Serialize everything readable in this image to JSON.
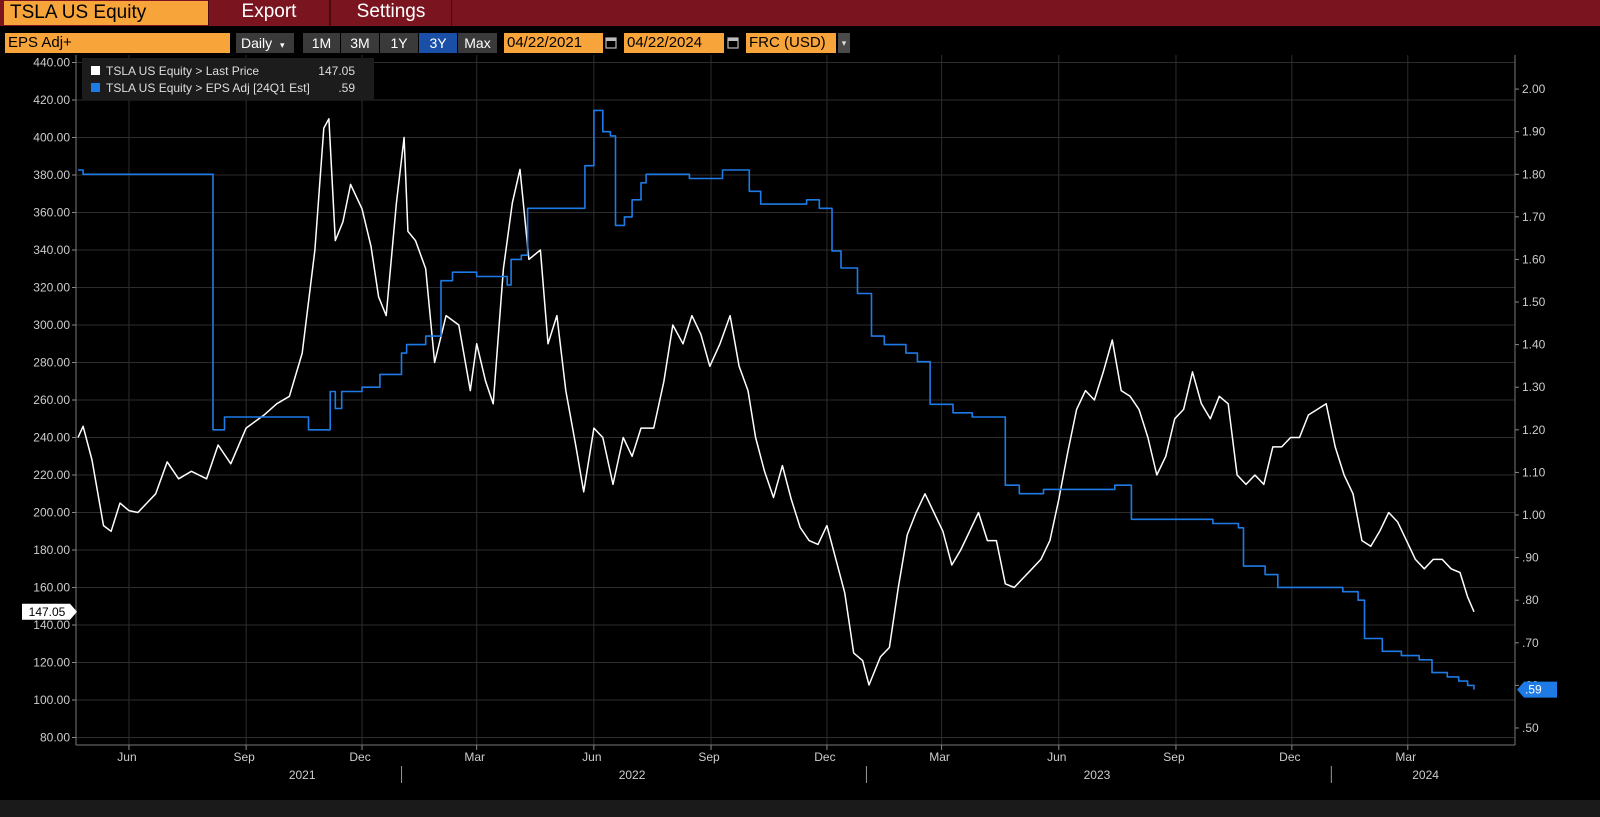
{
  "header": {
    "security": "TSLA US Equity",
    "menu": [
      "Export",
      "Settings"
    ]
  },
  "toolbar": {
    "field": "EPS Adj+",
    "periodicity": "Daily",
    "ranges": [
      "1M",
      "3M",
      "1Y",
      "3Y",
      "Max"
    ],
    "selected_range": "3Y",
    "start_date": "04/22/2021",
    "end_date": "04/22/2024",
    "currency": "FRC (USD)"
  },
  "colors": {
    "brand_bar": "#7a1520",
    "accent_orange": "#f7a43a",
    "price_line": "#ffffff",
    "eps_line": "#1e7be6",
    "grid": "#2c2c2c"
  },
  "chart_data": {
    "type": "line",
    "x_domain": [
      "2021-04-22",
      "2024-04-22"
    ],
    "x_month_ticks": [
      {
        "label": "Jun",
        "date": "2021-06-01"
      },
      {
        "label": "Sep",
        "date": "2021-09-01"
      },
      {
        "label": "Dec",
        "date": "2021-12-01"
      },
      {
        "label": "Mar",
        "date": "2022-03-01"
      },
      {
        "label": "Jun",
        "date": "2022-06-01"
      },
      {
        "label": "Sep",
        "date": "2022-09-01"
      },
      {
        "label": "Dec",
        "date": "2022-12-01"
      },
      {
        "label": "Mar",
        "date": "2023-03-01"
      },
      {
        "label": "Jun",
        "date": "2023-06-01"
      },
      {
        "label": "Sep",
        "date": "2023-09-01"
      },
      {
        "label": "Dec",
        "date": "2023-12-01"
      },
      {
        "label": "Mar",
        "date": "2024-03-01"
      }
    ],
    "x_year_labels": [
      {
        "label": "2021",
        "date": "2021-10-15"
      },
      {
        "label": "2022",
        "date": "2022-07-01"
      },
      {
        "label": "2023",
        "date": "2023-07-01"
      },
      {
        "label": "2024",
        "date": "2024-03-15"
      }
    ],
    "x_year_separators": [
      "2022-01-01",
      "2023-01-01",
      "2024-01-01"
    ],
    "left_axis": {
      "ylim": [
        76,
        444
      ],
      "ticks": [
        "440.00",
        "420.00",
        "400.00",
        "380.00",
        "360.00",
        "340.00",
        "320.00",
        "300.00",
        "280.00",
        "260.00",
        "240.00",
        "220.00",
        "200.00",
        "180.00",
        "160.00",
        "140.00",
        "120.00",
        "100.00",
        "80.00"
      ]
    },
    "right_axis": {
      "ylim": [
        0.46,
        2.08
      ],
      "ticks": [
        "2.00",
        "1.90",
        "1.80",
        "1.70",
        "1.60",
        "1.50",
        "1.40",
        "1.30",
        "1.20",
        "1.10",
        "1.00",
        ".90",
        ".80",
        ".70",
        ".60",
        ".50"
      ]
    },
    "legend": {
      "placement": "top-left",
      "items": [
        {
          "label": "TSLA US Equity > Last Price",
          "value": "147.05",
          "color": "#ffffff"
        },
        {
          "label": "TSLA US Equity > EPS Adj [24Q1 Est]",
          "value": ".59",
          "color": "#1e7be6"
        }
      ]
    },
    "last_value_labels": {
      "left": "147.05",
      "right": ".59"
    },
    "series": [
      {
        "name": "TSLA US Equity > Last Price",
        "axis": "left",
        "color": "#ffffff",
        "points": [
          [
            "2021-04-22",
            240
          ],
          [
            "2021-04-26",
            246
          ],
          [
            "2021-05-03",
            228
          ],
          [
            "2021-05-12",
            193
          ],
          [
            "2021-05-18",
            190
          ],
          [
            "2021-05-25",
            205
          ],
          [
            "2021-06-01",
            201
          ],
          [
            "2021-06-08",
            200
          ],
          [
            "2021-06-15",
            205
          ],
          [
            "2021-06-22",
            210
          ],
          [
            "2021-07-01",
            227
          ],
          [
            "2021-07-10",
            218
          ],
          [
            "2021-07-20",
            222
          ],
          [
            "2021-08-01",
            218
          ],
          [
            "2021-08-10",
            236
          ],
          [
            "2021-08-20",
            226
          ],
          [
            "2021-09-01",
            245
          ],
          [
            "2021-09-15",
            252
          ],
          [
            "2021-09-25",
            258
          ],
          [
            "2021-10-05",
            262
          ],
          [
            "2021-10-15",
            285
          ],
          [
            "2021-10-25",
            340
          ],
          [
            "2021-11-01",
            405
          ],
          [
            "2021-11-05",
            410
          ],
          [
            "2021-11-10",
            345
          ],
          [
            "2021-11-16",
            355
          ],
          [
            "2021-11-22",
            375
          ],
          [
            "2021-12-01",
            362
          ],
          [
            "2021-12-08",
            342
          ],
          [
            "2021-12-14",
            315
          ],
          [
            "2021-12-20",
            305
          ],
          [
            "2021-12-28",
            365
          ],
          [
            "2022-01-03",
            400
          ],
          [
            "2022-01-06",
            350
          ],
          [
            "2022-01-12",
            345
          ],
          [
            "2022-01-20",
            330
          ],
          [
            "2022-01-27",
            280
          ],
          [
            "2022-02-05",
            305
          ],
          [
            "2022-02-15",
            300
          ],
          [
            "2022-02-24",
            265
          ],
          [
            "2022-03-01",
            290
          ],
          [
            "2022-03-08",
            270
          ],
          [
            "2022-03-14",
            258
          ],
          [
            "2022-03-22",
            330
          ],
          [
            "2022-03-29",
            365
          ],
          [
            "2022-04-04",
            383
          ],
          [
            "2022-04-11",
            335
          ],
          [
            "2022-04-20",
            340
          ],
          [
            "2022-04-26",
            290
          ],
          [
            "2022-05-03",
            305
          ],
          [
            "2022-05-10",
            265
          ],
          [
            "2022-05-18",
            235
          ],
          [
            "2022-05-24",
            211
          ],
          [
            "2022-06-01",
            245
          ],
          [
            "2022-06-08",
            240
          ],
          [
            "2022-06-16",
            215
          ],
          [
            "2022-06-24",
            240
          ],
          [
            "2022-07-01",
            230
          ],
          [
            "2022-07-08",
            245
          ],
          [
            "2022-07-18",
            245
          ],
          [
            "2022-07-26",
            270
          ],
          [
            "2022-08-02",
            300
          ],
          [
            "2022-08-10",
            290
          ],
          [
            "2022-08-17",
            305
          ],
          [
            "2022-08-24",
            295
          ],
          [
            "2022-08-31",
            278
          ],
          [
            "2022-09-08",
            290
          ],
          [
            "2022-09-16",
            305
          ],
          [
            "2022-09-23",
            278
          ],
          [
            "2022-09-30",
            265
          ],
          [
            "2022-10-06",
            240
          ],
          [
            "2022-10-13",
            222
          ],
          [
            "2022-10-20",
            208
          ],
          [
            "2022-10-27",
            225
          ],
          [
            "2022-11-03",
            207
          ],
          [
            "2022-11-10",
            192
          ],
          [
            "2022-11-17",
            185
          ],
          [
            "2022-11-24",
            183
          ],
          [
            "2022-12-01",
            193
          ],
          [
            "2022-12-08",
            175
          ],
          [
            "2022-12-15",
            157
          ],
          [
            "2022-12-22",
            125
          ],
          [
            "2022-12-29",
            121
          ],
          [
            "2023-01-03",
            108
          ],
          [
            "2023-01-06",
            113
          ],
          [
            "2023-01-12",
            123
          ],
          [
            "2023-01-19",
            128
          ],
          [
            "2023-01-26",
            160
          ],
          [
            "2023-02-02",
            188
          ],
          [
            "2023-02-09",
            200
          ],
          [
            "2023-02-16",
            210
          ],
          [
            "2023-02-23",
            200
          ],
          [
            "2023-03-02",
            190
          ],
          [
            "2023-03-09",
            172
          ],
          [
            "2023-03-16",
            180
          ],
          [
            "2023-03-23",
            190
          ],
          [
            "2023-03-30",
            200
          ],
          [
            "2023-04-06",
            185
          ],
          [
            "2023-04-13",
            185
          ],
          [
            "2023-04-20",
            162
          ],
          [
            "2023-04-27",
            160
          ],
          [
            "2023-05-04",
            165
          ],
          [
            "2023-05-11",
            170
          ],
          [
            "2023-05-18",
            175
          ],
          [
            "2023-05-25",
            185
          ],
          [
            "2023-06-01",
            207
          ],
          [
            "2023-06-08",
            232
          ],
          [
            "2023-06-15",
            255
          ],
          [
            "2023-06-22",
            265
          ],
          [
            "2023-06-29",
            260
          ],
          [
            "2023-07-06",
            275
          ],
          [
            "2023-07-13",
            292
          ],
          [
            "2023-07-20",
            265
          ],
          [
            "2023-07-27",
            262
          ],
          [
            "2023-08-03",
            255
          ],
          [
            "2023-08-10",
            240
          ],
          [
            "2023-08-17",
            220
          ],
          [
            "2023-08-24",
            230
          ],
          [
            "2023-08-31",
            250
          ],
          [
            "2023-09-07",
            255
          ],
          [
            "2023-09-14",
            275
          ],
          [
            "2023-09-21",
            258
          ],
          [
            "2023-09-28",
            250
          ],
          [
            "2023-10-05",
            262
          ],
          [
            "2023-10-12",
            258
          ],
          [
            "2023-10-19",
            220
          ],
          [
            "2023-10-26",
            215
          ],
          [
            "2023-11-02",
            220
          ],
          [
            "2023-11-09",
            215
          ],
          [
            "2023-11-16",
            235
          ],
          [
            "2023-11-23",
            235
          ],
          [
            "2023-11-30",
            240
          ],
          [
            "2023-12-07",
            240
          ],
          [
            "2023-12-14",
            252
          ],
          [
            "2023-12-21",
            255
          ],
          [
            "2023-12-28",
            258
          ],
          [
            "2024-01-04",
            235
          ],
          [
            "2024-01-11",
            220
          ],
          [
            "2024-01-18",
            210
          ],
          [
            "2024-01-25",
            185
          ],
          [
            "2024-02-01",
            182
          ],
          [
            "2024-02-08",
            190
          ],
          [
            "2024-02-15",
            200
          ],
          [
            "2024-02-22",
            195
          ],
          [
            "2024-02-29",
            185
          ],
          [
            "2024-03-07",
            175
          ],
          [
            "2024-03-14",
            170
          ],
          [
            "2024-03-21",
            175
          ],
          [
            "2024-03-28",
            175
          ],
          [
            "2024-04-04",
            170
          ],
          [
            "2024-04-11",
            168
          ],
          [
            "2024-04-17",
            155
          ],
          [
            "2024-04-22",
            147.05
          ]
        ]
      },
      {
        "name": "TSLA US Equity > EPS Adj [24Q1 Est]",
        "axis": "right",
        "color": "#1e7be6",
        "points": [
          [
            "2021-04-22",
            1.81
          ],
          [
            "2021-04-26",
            1.8
          ],
          [
            "2021-08-05",
            1.8
          ],
          [
            "2021-08-06",
            1.2
          ],
          [
            "2021-08-15",
            1.23
          ],
          [
            "2021-10-10",
            1.23
          ],
          [
            "2021-10-20",
            1.2
          ],
          [
            "2021-11-05",
            1.2
          ],
          [
            "2021-11-06",
            1.29
          ],
          [
            "2021-11-10",
            1.25
          ],
          [
            "2021-11-15",
            1.29
          ],
          [
            "2021-12-01",
            1.3
          ],
          [
            "2021-12-15",
            1.33
          ],
          [
            "2022-01-01",
            1.38
          ],
          [
            "2022-01-05",
            1.4
          ],
          [
            "2022-01-20",
            1.42
          ],
          [
            "2022-02-01",
            1.55
          ],
          [
            "2022-02-10",
            1.57
          ],
          [
            "2022-03-01",
            1.56
          ],
          [
            "2022-03-20",
            1.56
          ],
          [
            "2022-03-25",
            1.54
          ],
          [
            "2022-03-28",
            1.6
          ],
          [
            "2022-04-05",
            1.61
          ],
          [
            "2022-04-10",
            1.72
          ],
          [
            "2022-04-20",
            1.72
          ],
          [
            "2022-05-20",
            1.72
          ],
          [
            "2022-05-25",
            1.82
          ],
          [
            "2022-06-01",
            1.95
          ],
          [
            "2022-06-08",
            1.9
          ],
          [
            "2022-06-14",
            1.89
          ],
          [
            "2022-06-18",
            1.68
          ],
          [
            "2022-06-25",
            1.7
          ],
          [
            "2022-07-01",
            1.74
          ],
          [
            "2022-07-08",
            1.78
          ],
          [
            "2022-07-12",
            1.8
          ],
          [
            "2022-08-10",
            1.8
          ],
          [
            "2022-08-15",
            1.79
          ],
          [
            "2022-09-05",
            1.79
          ],
          [
            "2022-09-10",
            1.81
          ],
          [
            "2022-09-28",
            1.81
          ],
          [
            "2022-10-01",
            1.76
          ],
          [
            "2022-10-10",
            1.73
          ],
          [
            "2022-10-20",
            1.73
          ],
          [
            "2022-11-10",
            1.73
          ],
          [
            "2022-11-15",
            1.74
          ],
          [
            "2022-11-25",
            1.72
          ],
          [
            "2022-12-05",
            1.62
          ],
          [
            "2022-12-12",
            1.58
          ],
          [
            "2022-12-25",
            1.52
          ],
          [
            "2023-01-05",
            1.42
          ],
          [
            "2023-01-15",
            1.4
          ],
          [
            "2023-02-01",
            1.38
          ],
          [
            "2023-02-10",
            1.36
          ],
          [
            "2023-02-20",
            1.26
          ],
          [
            "2023-03-10",
            1.24
          ],
          [
            "2023-03-25",
            1.23
          ],
          [
            "2023-04-10",
            1.23
          ],
          [
            "2023-04-20",
            1.07
          ],
          [
            "2023-05-01",
            1.05
          ],
          [
            "2023-05-20",
            1.06
          ],
          [
            "2023-06-15",
            1.06
          ],
          [
            "2023-07-15",
            1.07
          ],
          [
            "2023-07-25",
            1.07
          ],
          [
            "2023-07-28",
            0.99
          ],
          [
            "2023-08-30",
            0.99
          ],
          [
            "2023-09-30",
            0.98
          ],
          [
            "2023-10-20",
            0.97
          ],
          [
            "2023-10-24",
            0.88
          ],
          [
            "2023-11-10",
            0.86
          ],
          [
            "2023-11-20",
            0.83
          ],
          [
            "2023-12-10",
            0.83
          ],
          [
            "2023-12-25",
            0.83
          ],
          [
            "2024-01-10",
            0.82
          ],
          [
            "2024-01-22",
            0.8
          ],
          [
            "2024-01-27",
            0.71
          ],
          [
            "2024-02-10",
            0.68
          ],
          [
            "2024-02-25",
            0.67
          ],
          [
            "2024-03-10",
            0.66
          ],
          [
            "2024-03-20",
            0.63
          ],
          [
            "2024-04-01",
            0.62
          ],
          [
            "2024-04-10",
            0.61
          ],
          [
            "2024-04-17",
            0.6
          ],
          [
            "2024-04-22",
            0.59
          ]
        ]
      }
    ]
  }
}
